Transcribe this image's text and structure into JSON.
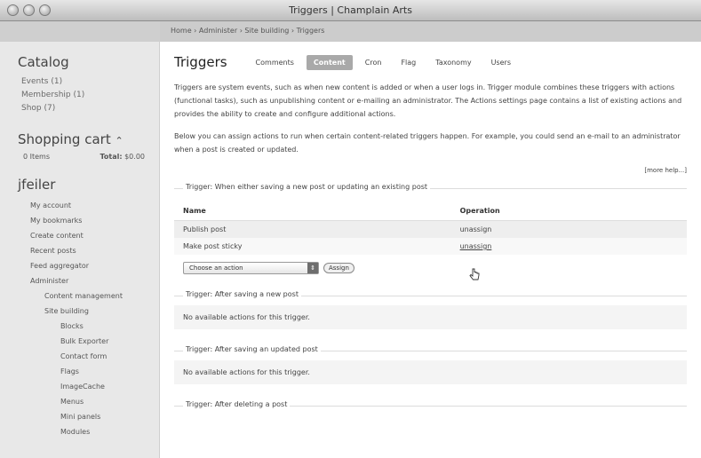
{
  "window": {
    "title": "Triggers | Champlain Arts"
  },
  "breadcrumb": "Home › Administer › Site building › Triggers",
  "sidebar": {
    "catalog": {
      "title": "Catalog",
      "items": [
        "Events (1)",
        "Membership (1)",
        "Shop (7)"
      ]
    },
    "cart": {
      "title": "Shopping cart",
      "items_label": "0 Items",
      "total_label": "Total:",
      "total_value": "$0.00"
    },
    "user": {
      "title": "jfeiler",
      "nav": [
        {
          "label": "My account",
          "level": 0
        },
        {
          "label": "My bookmarks",
          "level": 0
        },
        {
          "label": "Create content",
          "level": 0
        },
        {
          "label": "Recent posts",
          "level": 0
        },
        {
          "label": "Feed aggregator",
          "level": 0
        },
        {
          "label": "Administer",
          "level": 0
        },
        {
          "label": "Content management",
          "level": 1
        },
        {
          "label": "Site building",
          "level": 1
        },
        {
          "label": "Blocks",
          "level": 2
        },
        {
          "label": "Bulk Exporter",
          "level": 2
        },
        {
          "label": "Contact form",
          "level": 2
        },
        {
          "label": "Flags",
          "level": 2
        },
        {
          "label": "ImageCache",
          "level": 2
        },
        {
          "label": "Menus",
          "level": 2
        },
        {
          "label": "Mini panels",
          "level": 2
        },
        {
          "label": "Modules",
          "level": 2
        }
      ]
    }
  },
  "main": {
    "page_title": "Triggers",
    "tabs": [
      {
        "label": "Comments",
        "active": false
      },
      {
        "label": "Content",
        "active": true
      },
      {
        "label": "Cron",
        "active": false
      },
      {
        "label": "Flag",
        "active": false
      },
      {
        "label": "Taxonomy",
        "active": false
      },
      {
        "label": "Users",
        "active": false
      }
    ],
    "intro": "Triggers are system events, such as when new content is added or when a user logs in. Trigger module combines these triggers with actions (functional tasks), such as unpublishing content or e-mailing an administrator. The Actions settings page contains a list of existing actions and provides the ability to create and configure additional actions.",
    "description": "Below you can assign actions to run when certain content-related triggers happen. For example, you could send an e-mail to an administrator when a post is created or updated.",
    "more_help": "[more help...]",
    "triggers": [
      {
        "legend": "Trigger: When either saving a new post or updating an existing post",
        "columns": [
          "Name",
          "Operation"
        ],
        "rows": [
          {
            "name": "Publish post",
            "operation": "unassign"
          },
          {
            "name": "Make post sticky",
            "operation": "unassign"
          }
        ],
        "select_value": "Choose an action",
        "assign_label": "Assign"
      },
      {
        "legend": "Trigger: After saving a new post",
        "empty_text": "No available actions for this trigger."
      },
      {
        "legend": "Trigger: After saving an updated post",
        "empty_text": "No available actions for this trigger."
      },
      {
        "legend": "Trigger: After deleting a post"
      }
    ]
  },
  "icons": {
    "cart_toggle": "caret-up-icon",
    "select_arrow": "double-arrow-icon",
    "cursor": "hand-pointer-icon"
  }
}
